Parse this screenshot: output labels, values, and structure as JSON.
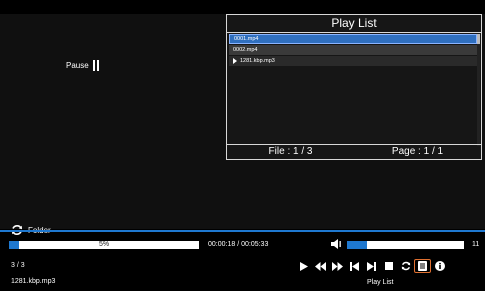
{
  "player": {
    "status_label": "Pause",
    "folder_label": "Folder",
    "progress_text": "5%",
    "progress_fraction": 0.05,
    "time_text": "00:00:18 / 00:05:33",
    "volume_value": "11",
    "volume_fraction": 0.17,
    "track_count": "3 / 3",
    "current_file": "1281.kbp.mp3",
    "focused_control_label": "Play List"
  },
  "playlist": {
    "title": "Play List",
    "items": [
      {
        "name": "0001.mp4",
        "state": "selected"
      },
      {
        "name": "0002.mp4",
        "state": "normal"
      },
      {
        "name": "1281.kbp.mp3",
        "state": "playing"
      }
    ],
    "file_info": "File : 1 / 3",
    "page_info": "Page : 1 / 1"
  },
  "controls": [
    {
      "name": "play-icon"
    },
    {
      "name": "rewind-icon"
    },
    {
      "name": "fast-forward-icon"
    },
    {
      "name": "previous-track-icon"
    },
    {
      "name": "next-track-icon"
    },
    {
      "name": "stop-icon"
    },
    {
      "name": "repeat-icon"
    },
    {
      "name": "playlist-icon"
    },
    {
      "name": "info-icon"
    }
  ],
  "colors": {
    "accent": "#1e78d0",
    "focus": "#e07030",
    "background": "#000000"
  }
}
